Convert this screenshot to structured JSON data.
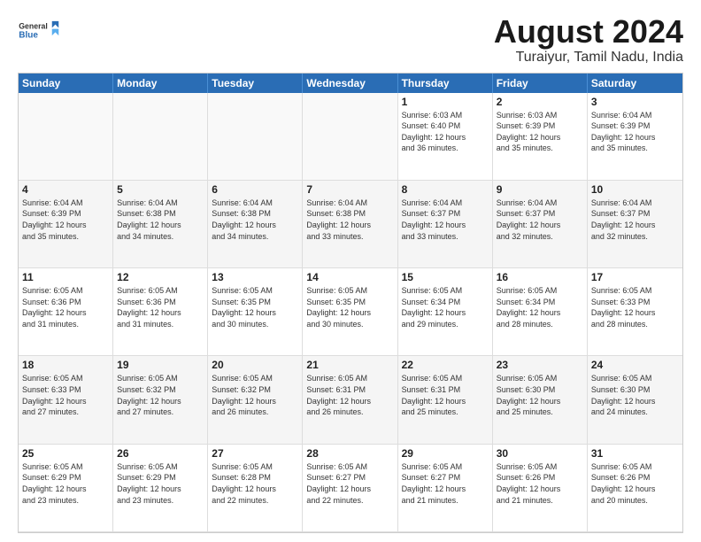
{
  "logo": {
    "general": "General",
    "blue": "Blue"
  },
  "title": {
    "month_year": "August 2024",
    "location": "Turaiyur, Tamil Nadu, India"
  },
  "weekdays": [
    "Sunday",
    "Monday",
    "Tuesday",
    "Wednesday",
    "Thursday",
    "Friday",
    "Saturday"
  ],
  "weeks": [
    [
      {
        "day": "",
        "info": "",
        "empty": true
      },
      {
        "day": "",
        "info": "",
        "empty": true
      },
      {
        "day": "",
        "info": "",
        "empty": true
      },
      {
        "day": "",
        "info": "",
        "empty": true
      },
      {
        "day": "1",
        "info": "Sunrise: 6:03 AM\nSunset: 6:40 PM\nDaylight: 12 hours\nand 36 minutes."
      },
      {
        "day": "2",
        "info": "Sunrise: 6:03 AM\nSunset: 6:39 PM\nDaylight: 12 hours\nand 35 minutes."
      },
      {
        "day": "3",
        "info": "Sunrise: 6:04 AM\nSunset: 6:39 PM\nDaylight: 12 hours\nand 35 minutes."
      }
    ],
    [
      {
        "day": "4",
        "info": "Sunrise: 6:04 AM\nSunset: 6:39 PM\nDaylight: 12 hours\nand 35 minutes."
      },
      {
        "day": "5",
        "info": "Sunrise: 6:04 AM\nSunset: 6:38 PM\nDaylight: 12 hours\nand 34 minutes."
      },
      {
        "day": "6",
        "info": "Sunrise: 6:04 AM\nSunset: 6:38 PM\nDaylight: 12 hours\nand 34 minutes."
      },
      {
        "day": "7",
        "info": "Sunrise: 6:04 AM\nSunset: 6:38 PM\nDaylight: 12 hours\nand 33 minutes."
      },
      {
        "day": "8",
        "info": "Sunrise: 6:04 AM\nSunset: 6:37 PM\nDaylight: 12 hours\nand 33 minutes."
      },
      {
        "day": "9",
        "info": "Sunrise: 6:04 AM\nSunset: 6:37 PM\nDaylight: 12 hours\nand 32 minutes."
      },
      {
        "day": "10",
        "info": "Sunrise: 6:04 AM\nSunset: 6:37 PM\nDaylight: 12 hours\nand 32 minutes."
      }
    ],
    [
      {
        "day": "11",
        "info": "Sunrise: 6:05 AM\nSunset: 6:36 PM\nDaylight: 12 hours\nand 31 minutes."
      },
      {
        "day": "12",
        "info": "Sunrise: 6:05 AM\nSunset: 6:36 PM\nDaylight: 12 hours\nand 31 minutes."
      },
      {
        "day": "13",
        "info": "Sunrise: 6:05 AM\nSunset: 6:35 PM\nDaylight: 12 hours\nand 30 minutes."
      },
      {
        "day": "14",
        "info": "Sunrise: 6:05 AM\nSunset: 6:35 PM\nDaylight: 12 hours\nand 30 minutes."
      },
      {
        "day": "15",
        "info": "Sunrise: 6:05 AM\nSunset: 6:34 PM\nDaylight: 12 hours\nand 29 minutes."
      },
      {
        "day": "16",
        "info": "Sunrise: 6:05 AM\nSunset: 6:34 PM\nDaylight: 12 hours\nand 28 minutes."
      },
      {
        "day": "17",
        "info": "Sunrise: 6:05 AM\nSunset: 6:33 PM\nDaylight: 12 hours\nand 28 minutes."
      }
    ],
    [
      {
        "day": "18",
        "info": "Sunrise: 6:05 AM\nSunset: 6:33 PM\nDaylight: 12 hours\nand 27 minutes."
      },
      {
        "day": "19",
        "info": "Sunrise: 6:05 AM\nSunset: 6:32 PM\nDaylight: 12 hours\nand 27 minutes."
      },
      {
        "day": "20",
        "info": "Sunrise: 6:05 AM\nSunset: 6:32 PM\nDaylight: 12 hours\nand 26 minutes."
      },
      {
        "day": "21",
        "info": "Sunrise: 6:05 AM\nSunset: 6:31 PM\nDaylight: 12 hours\nand 26 minutes."
      },
      {
        "day": "22",
        "info": "Sunrise: 6:05 AM\nSunset: 6:31 PM\nDaylight: 12 hours\nand 25 minutes."
      },
      {
        "day": "23",
        "info": "Sunrise: 6:05 AM\nSunset: 6:30 PM\nDaylight: 12 hours\nand 25 minutes."
      },
      {
        "day": "24",
        "info": "Sunrise: 6:05 AM\nSunset: 6:30 PM\nDaylight: 12 hours\nand 24 minutes."
      }
    ],
    [
      {
        "day": "25",
        "info": "Sunrise: 6:05 AM\nSunset: 6:29 PM\nDaylight: 12 hours\nand 23 minutes."
      },
      {
        "day": "26",
        "info": "Sunrise: 6:05 AM\nSunset: 6:29 PM\nDaylight: 12 hours\nand 23 minutes."
      },
      {
        "day": "27",
        "info": "Sunrise: 6:05 AM\nSunset: 6:28 PM\nDaylight: 12 hours\nand 22 minutes."
      },
      {
        "day": "28",
        "info": "Sunrise: 6:05 AM\nSunset: 6:27 PM\nDaylight: 12 hours\nand 22 minutes."
      },
      {
        "day": "29",
        "info": "Sunrise: 6:05 AM\nSunset: 6:27 PM\nDaylight: 12 hours\nand 21 minutes."
      },
      {
        "day": "30",
        "info": "Sunrise: 6:05 AM\nSunset: 6:26 PM\nDaylight: 12 hours\nand 21 minutes."
      },
      {
        "day": "31",
        "info": "Sunrise: 6:05 AM\nSunset: 6:26 PM\nDaylight: 12 hours\nand 20 minutes."
      }
    ]
  ]
}
